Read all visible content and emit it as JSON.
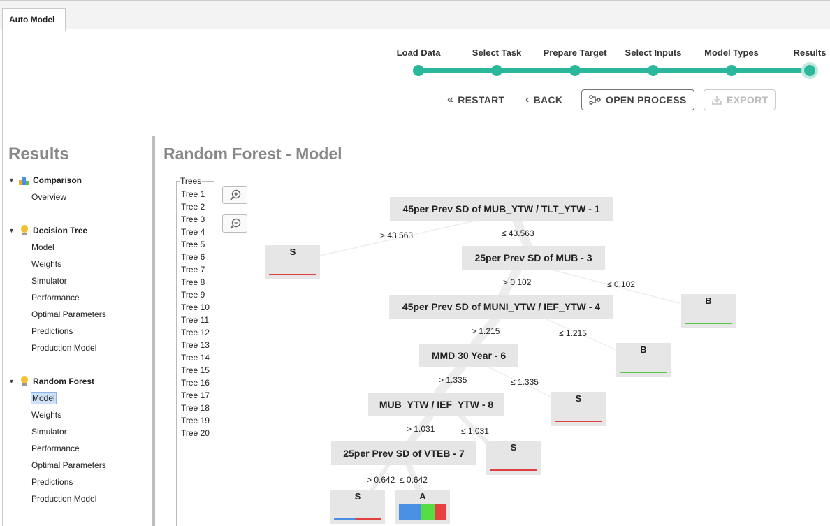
{
  "tab": {
    "label": "Auto Model"
  },
  "steps": [
    {
      "label": "Load Data"
    },
    {
      "label": "Select Task"
    },
    {
      "label": "Prepare Target"
    },
    {
      "label": "Select Inputs"
    },
    {
      "label": "Model Types"
    },
    {
      "label": "Results"
    }
  ],
  "actions": {
    "restart": "RESTART",
    "back": "BACK",
    "open_process": "OPEN PROCESS",
    "export": "EXPORT"
  },
  "sidebar": {
    "title": "Results",
    "groups": [
      {
        "label": "Comparison",
        "icon": "bar-chart-icon",
        "items": [
          "Overview"
        ]
      },
      {
        "label": "Decision Tree",
        "icon": "lightbulb-icon",
        "items": [
          "Model",
          "Weights",
          "Simulator",
          "Performance",
          "Optimal Parameters",
          "Predictions",
          "Production Model"
        ]
      },
      {
        "label": "Random Forest",
        "icon": "lightbulb-icon",
        "items": [
          "Model",
          "Weights",
          "Simulator",
          "Performance",
          "Optimal Parameters",
          "Predictions",
          "Production Model"
        ],
        "selected": "Model"
      }
    ]
  },
  "main": {
    "title": "Random Forest - Model",
    "trees_legend": "Trees",
    "trees": [
      "Tree 1",
      "Tree 2",
      "Tree 3",
      "Tree 4",
      "Tree 5",
      "Tree 6",
      "Tree 7",
      "Tree 8",
      "Tree 9",
      "Tree 10",
      "Tree 11",
      "Tree 12",
      "Tree 13",
      "Tree 14",
      "Tree 15",
      "Tree 16",
      "Tree 17",
      "Tree 18",
      "Tree 19",
      "Tree 20"
    ]
  },
  "tree": {
    "nodes": [
      {
        "label": "45per Prev SD of MUB_YTW / TLT_YTW - 1"
      },
      {
        "label": "25per Prev SD of MUB - 3"
      },
      {
        "label": "45per Prev SD of MUNI_YTW / IEF_YTW - 4"
      },
      {
        "label": "MMD 30 Year - 6"
      },
      {
        "label": "MUB_YTW / IEF_YTW - 8"
      },
      {
        "label": "25per Prev SD of VTEB - 7"
      }
    ],
    "leaves": [
      {
        "label": "S",
        "bar_color": "#e04040"
      },
      {
        "label": "B",
        "bar_color": "#55cc44"
      },
      {
        "label": "B",
        "bar_color": "#55cc44"
      },
      {
        "label": "S",
        "bar_color": "#e04040"
      },
      {
        "label": "S",
        "bar_color": "#e04040"
      },
      {
        "label": "S",
        "bar_color": "#e04040"
      },
      {
        "label": "A",
        "bar_color": "mixed"
      }
    ],
    "edges": [
      {
        "label": "> 43.563"
      },
      {
        "label": "≤ 43.563"
      },
      {
        "label": "> 0.102"
      },
      {
        "label": "≤ 0.102"
      },
      {
        "label": "> 1.215"
      },
      {
        "label": "≤ 1.215"
      },
      {
        "label": "> 1.335"
      },
      {
        "label": "≤ 1.335"
      },
      {
        "label": "> 1.031"
      },
      {
        "label": "≤ 1.031"
      },
      {
        "label": "> 0.642"
      },
      {
        "label": "≤ 0.642"
      }
    ]
  },
  "colors": {
    "accent": "#2ab79c",
    "node_bg": "#e6e6e6",
    "class_s": "#e04040",
    "class_b": "#55cc44",
    "class_a_blue": "#4a90e2"
  }
}
